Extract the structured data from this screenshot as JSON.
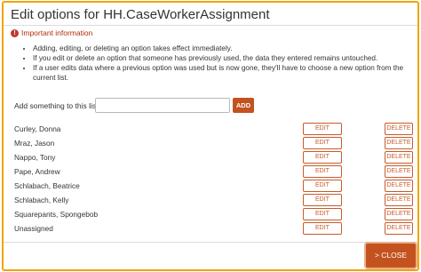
{
  "dialog": {
    "title": "Edit options for HH.CaseWorkerAssignment",
    "important_icon": "exclamation-icon",
    "important_label": "Important information",
    "notes": [
      "Adding, editing, or deleting an option takes effect immediately.",
      "If you edit or delete an option that someone has previously used, the data they entered remains untouched.",
      "If a user edits data where a previous option was used but is now gone, they'll have to choose a new option from the current list."
    ]
  },
  "add": {
    "label": "Add something to this list",
    "value": "",
    "button_label": "ADD"
  },
  "options": [
    {
      "name": "Curley, Donna",
      "edit_label": "EDIT",
      "delete_label": "DELETE"
    },
    {
      "name": "Mraz, Jason",
      "edit_label": "EDIT",
      "delete_label": "DELETE"
    },
    {
      "name": "Nappo, Tony",
      "edit_label": "EDIT",
      "delete_label": "DELETE"
    },
    {
      "name": "Pape, Andrew",
      "edit_label": "EDIT",
      "delete_label": "DELETE"
    },
    {
      "name": "Schlabach, Beatrice",
      "edit_label": "EDIT",
      "delete_label": "DELETE"
    },
    {
      "name": "Schlabach, Kelly",
      "edit_label": "EDIT",
      "delete_label": "DELETE"
    },
    {
      "name": "Squarepants, Spongebob",
      "edit_label": "EDIT",
      "delete_label": "DELETE"
    },
    {
      "name": "Unassigned",
      "edit_label": "EDIT",
      "delete_label": "DELETE"
    }
  ],
  "footer": {
    "close_label": "> CLOSE"
  },
  "colors": {
    "accent": "#c3521f",
    "frame_border": "#f0a500",
    "important_text": "#b52c0e"
  }
}
